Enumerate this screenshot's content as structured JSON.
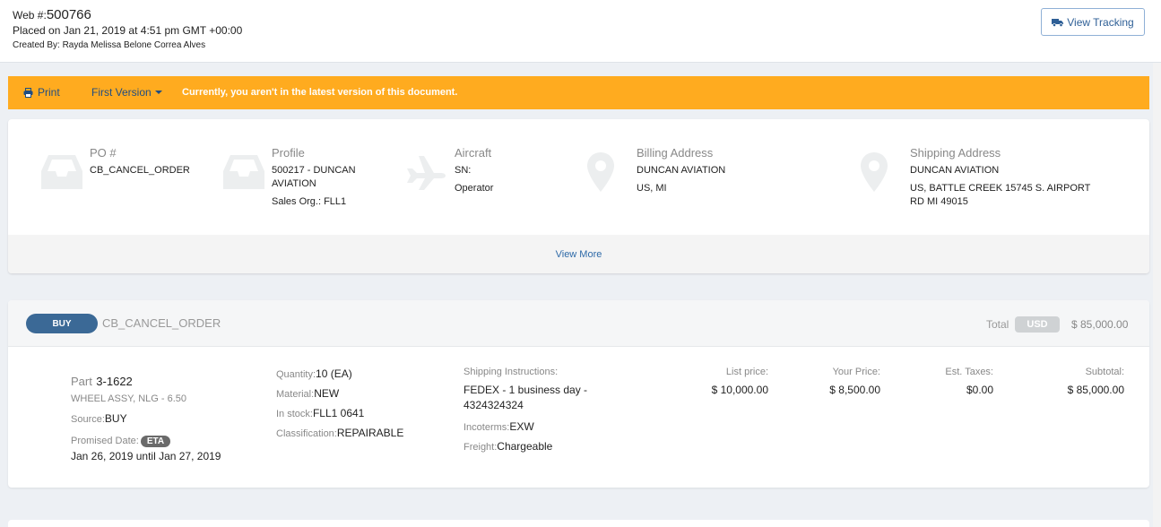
{
  "header": {
    "web_prefix": "Web #:",
    "web_number": "500766",
    "placed": "Placed on Jan 21, 2019 at 4:51 pm GMT +00:00",
    "created_by": "Created By: Rayda Melissa Belone Correa Alves",
    "view_tracking_label": "View Tracking"
  },
  "notice": {
    "print_label": "Print",
    "version_label": "First Version",
    "message": "Currently, you aren't in the latest version of this document.",
    "background_color": "#ffab1f"
  },
  "info": {
    "po": {
      "title": "PO #",
      "value": "CB_CANCEL_ORDER",
      "icon": "inbox-icon"
    },
    "profile": {
      "title": "Profile",
      "line1": "500217 - DUNCAN",
      "line2": "AVIATION",
      "line3": "Sales Org.: FLL1",
      "icon": "inbox-icon"
    },
    "aircraft": {
      "title": "Aircraft",
      "line1": "SN:",
      "line2": "Operator",
      "icon": "airplane-icon"
    },
    "billing": {
      "title": "Billing Address",
      "line1": "DUNCAN AVIATION",
      "line2": "US, MI",
      "icon": "map-pin-icon"
    },
    "shipping": {
      "title": "Shipping Address",
      "line1": "DUNCAN AVIATION",
      "line2": "US, BATTLE CREEK 15745 S. AIRPORT",
      "line3": "RD MI 49015",
      "icon": "map-pin-icon"
    },
    "view_more": "View More"
  },
  "order": {
    "type_badge": "BUY",
    "order_id": "CB_CANCEL_ORDER",
    "total_label": "Total",
    "currency": "USD",
    "total_amount": "$ 85,000.00",
    "part_label": "Part",
    "part_number": "3-1622",
    "part_description": "WHEEL ASSY, NLG - 6.50",
    "source_label": "Source:",
    "source_value": "BUY",
    "promised_label": "Promised Date:",
    "eta_badge": "ETA",
    "promised_range": "Jan 26, 2019 until Jan 27, 2019",
    "quantity_label": "Quantity:",
    "quantity_value": "10 (EA)",
    "material_label": "Material:",
    "material_value": "NEW",
    "stock_label": "In stock:",
    "stock_value": "FLL1 0641",
    "classification_label": "Classification:",
    "classification_value": "REPAIRABLE",
    "shipping_instructions_label": "Shipping Instructions:",
    "shipping_instructions_line1": "FEDEX - 1 business day -",
    "shipping_instructions_line2": "4324324324",
    "incoterms_label": "Incoterms:",
    "incoterms_value": "EXW",
    "freight_label": "Freight:",
    "freight_value": "Chargeable",
    "list_price_label": "List price:",
    "list_price_value": "$ 10,000.00",
    "your_price_label": "Your Price:",
    "your_price_value": "$ 8,500.00",
    "taxes_label": "Est. Taxes:",
    "taxes_value": "$0.00",
    "subtotal_label": "Subtotal:",
    "subtotal_value": "$ 85,000.00"
  }
}
